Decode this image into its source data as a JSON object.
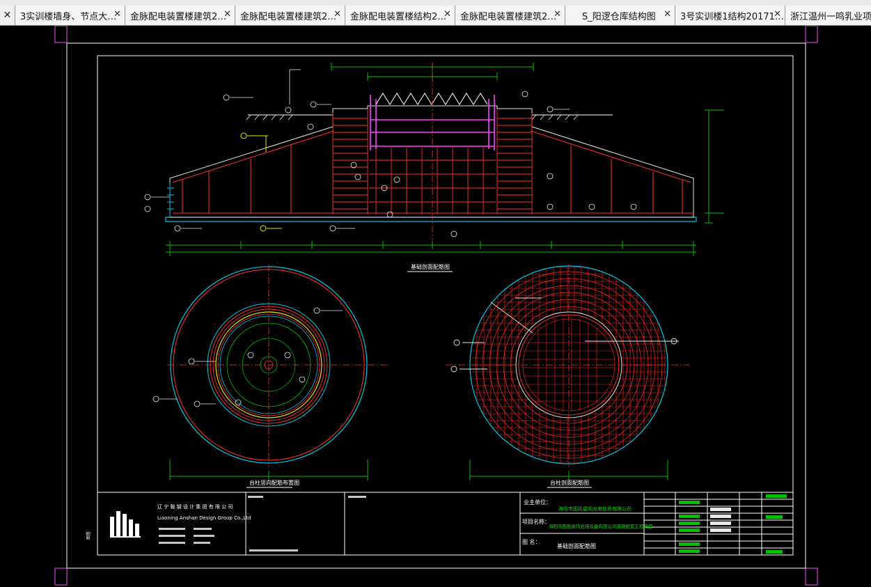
{
  "tabs": [
    {
      "label": "3实训楼墙身、节点大…"
    },
    {
      "label": "金脉配电装置楼建筑2…"
    },
    {
      "label": "金脉配电装置楼建筑2…"
    },
    {
      "label": "金脉配电装置楼结构2…"
    },
    {
      "label": "金脉配电装置楼建筑2…"
    },
    {
      "label": "S_阳逻仓库结构图"
    },
    {
      "label": "3号实训楼1结构20171…"
    },
    {
      "label": "浙江温州一鸣乳业项…"
    }
  ],
  "drawing": {
    "section_title": "基础剖面配筋图",
    "plan_left_title": "台柱竖向配筋布置图",
    "plan_right_title": "台柱剖面配筋图"
  },
  "title_block": {
    "company_cn": "辽 宁 鞍 钢 设 计 集 团 有 限 公 司",
    "company_en": "Liaoning Anshan Design Group Co.,Ltd",
    "owner_label": "业主单位：",
    "owner_value": "海阳市国民星际光电投资有限公司",
    "project_label": "项目名称：",
    "project_value": "海阳市国民星际光电设备有限公司道路配套工程项目",
    "drawing_name_label": "图    名：",
    "drawing_name_value": "基础剖面配筋图",
    "side_label": "图签"
  }
}
